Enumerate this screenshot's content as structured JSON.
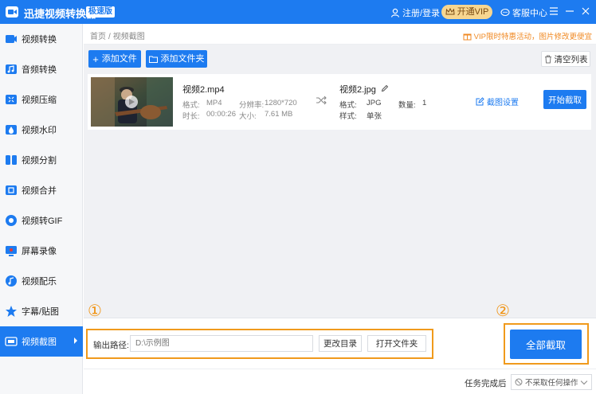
{
  "titlebar": {
    "app_title": "迅捷视频转换器",
    "speed_badge": "极速版",
    "login": "注册/登录",
    "vip": "开通VIP",
    "service": "客服中心"
  },
  "sidebar": {
    "items": [
      {
        "label": "视频转换",
        "icon": "video-convert-icon"
      },
      {
        "label": "音频转换",
        "icon": "audio-convert-icon"
      },
      {
        "label": "视频压缩",
        "icon": "video-compress-icon"
      },
      {
        "label": "视频水印",
        "icon": "video-watermark-icon"
      },
      {
        "label": "视频分割",
        "icon": "video-split-icon"
      },
      {
        "label": "视频合并",
        "icon": "video-merge-icon"
      },
      {
        "label": "视频转GIF",
        "icon": "gif-icon"
      },
      {
        "label": "屏幕录像",
        "icon": "screen-record-icon"
      },
      {
        "label": "视频配乐",
        "icon": "music-icon"
      },
      {
        "label": "字幕/贴图",
        "icon": "subtitle-star-icon"
      },
      {
        "label": "视频截图",
        "icon": "screenshot-icon",
        "active": true
      }
    ]
  },
  "breadcrumb": {
    "home": "首页",
    "sep": "/",
    "current": "视频截图"
  },
  "promo": "VIP限时特惠活动，图片修改更便宜",
  "toolbar": {
    "add_file": "添加文件",
    "add_folder": "添加文件夹",
    "clear_list": "清空列表"
  },
  "file": {
    "name": "视频2.mp4",
    "format_label": "格式:",
    "format": "MP4",
    "resolution_label": "分辨率:",
    "resolution": "1280*720",
    "duration_label": "时长:",
    "duration": "00:00:26",
    "size_label": "大小:",
    "size": "7.61 MB",
    "output_name": "视频2.jpg",
    "out_format_label": "格式:",
    "out_format": "JPG",
    "count_label": "数量:",
    "count": "1",
    "style_label": "样式:",
    "style": "单张",
    "shot_settings": "截图设置",
    "start": "开始截取"
  },
  "output": {
    "label": "输出路径:",
    "path": "D:\\示例图",
    "change_dir": "更改目录",
    "open_folder": "打开文件夹",
    "capture_all": "全部截取",
    "marker1": "①",
    "marker2": "②"
  },
  "status": {
    "label": "任务完成后",
    "option": "不采取任何操作"
  },
  "colors": {
    "accent": "#1d7bf0",
    "highlight": "#f09a1c",
    "vip_bg": "#f7d690"
  }
}
